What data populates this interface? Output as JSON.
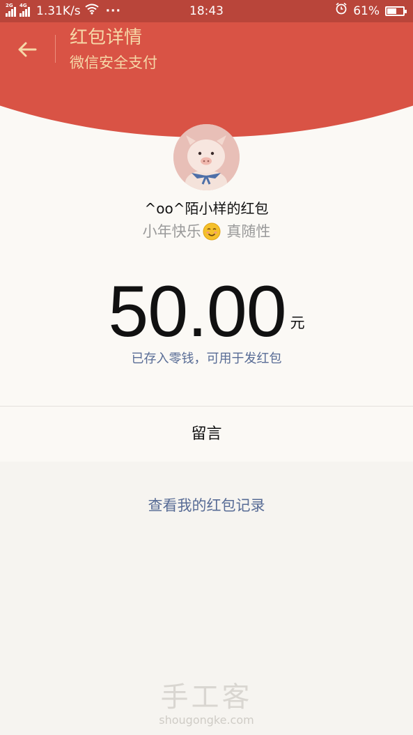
{
  "status_bar": {
    "network_1": "2G",
    "network_2": "4G",
    "speed": "1.31K/s",
    "more": "···",
    "time": "18:43",
    "battery": "61%",
    "battery_level": 0.61
  },
  "header": {
    "title": "红包详情",
    "subtitle": "微信安全支付"
  },
  "sender": {
    "name": "^oo^陌小样的红包",
    "greeting_before": "小年快乐",
    "greeting_after": " 真随性"
  },
  "amount": {
    "value": "50.00",
    "unit": "元",
    "note": "已存入零钱，可用于发红包"
  },
  "message": {
    "label": "留言"
  },
  "history": {
    "link": "查看我的红包记录"
  },
  "watermark": {
    "title": "手工客",
    "url": "shougongke.com"
  },
  "colors": {
    "status_bar": "#b9453a",
    "header_red": "#d95345",
    "header_gold": "#f6d8a8",
    "link_blue": "#576b95"
  }
}
